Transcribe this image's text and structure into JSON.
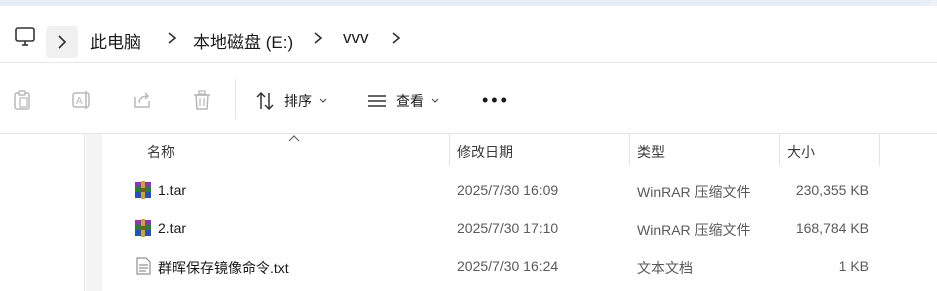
{
  "address": {
    "breadcrumb": [
      "此电脑",
      "本地磁盘 (E:)",
      "vvv"
    ]
  },
  "toolbar": {
    "sort_label": "排序",
    "view_label": "查看",
    "more_label": "•••"
  },
  "columns": {
    "name": "名称",
    "modified": "修改日期",
    "type": "类型",
    "size": "大小"
  },
  "files": [
    {
      "name": "1.tar",
      "modified": "2025/7/30 16:09",
      "type": "WinRAR 压缩文件",
      "size": "230,355 KB",
      "icon": "winrar-archive-icon"
    },
    {
      "name": "2.tar",
      "modified": "2025/7/30 17:10",
      "type": "WinRAR 压缩文件",
      "size": "168,784 KB",
      "icon": "winrar-archive-icon"
    },
    {
      "name": "群晖保存镜像命令.txt",
      "modified": "2025/7/30 16:24",
      "type": "文本文档",
      "size": "1 KB",
      "icon": "text-file-icon"
    }
  ]
}
